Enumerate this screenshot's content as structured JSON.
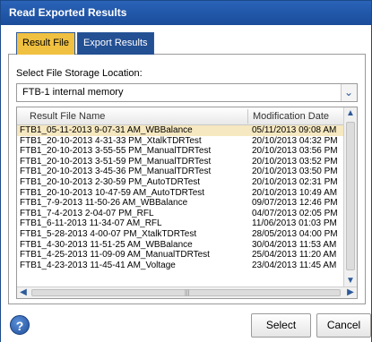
{
  "window": {
    "title": "Read Exported Results"
  },
  "tabs": [
    {
      "label": "Result File",
      "active": true
    },
    {
      "label": "Export Results",
      "active": false
    }
  ],
  "storage": {
    "label": "Select File Storage Location:",
    "selected": "FTB-1 internal memory"
  },
  "list": {
    "columns": {
      "name": "Result File Name",
      "date": "Modification Date"
    },
    "rows": [
      {
        "name": "FTB1_05-11-2013 9-07-31 AM_WBBalance",
        "date": "05/11/2013 09:08 AM"
      },
      {
        "name": "FTB1_20-10-2013 4-31-33 PM_XtalkTDRTest",
        "date": "20/10/2013 04:32 PM"
      },
      {
        "name": "FTB1_20-10-2013 3-55-55 PM_ManualTDRTest",
        "date": "20/10/2013 03:56 PM"
      },
      {
        "name": "FTB1_20-10-2013 3-51-59 PM_ManualTDRTest",
        "date": "20/10/2013 03:52 PM"
      },
      {
        "name": "FTB1_20-10-2013 3-45-36 PM_ManualTDRTest",
        "date": "20/10/2013 03:50 PM"
      },
      {
        "name": "FTB1_20-10-2013 2-30-59 PM_AutoTDRTest",
        "date": "20/10/2013 02:31 PM"
      },
      {
        "name": "FTB1_20-10-2013 10-47-59 AM_AutoTDRTest",
        "date": "20/10/2013 10:49 AM"
      },
      {
        "name": "FTB1_7-9-2013 11-50-26 AM_WBBalance",
        "date": "09/07/2013 12:46 PM"
      },
      {
        "name": "FTB1_7-4-2013 2-04-07 PM_RFL",
        "date": "04/07/2013 02:05 PM"
      },
      {
        "name": "FTB1_6-11-2013 11-34-07 AM_RFL",
        "date": "11/06/2013 01:03 PM"
      },
      {
        "name": "FTB1_5-28-2013 4-00-07 PM_XtalkTDRTest",
        "date": "28/05/2013 04:00 PM"
      },
      {
        "name": "FTB1_4-30-2013 11-51-25 AM_WBBalance",
        "date": "30/04/2013 11:53 AM"
      },
      {
        "name": "FTB1_4-25-2013 11-09-09 AM_ManualTDRTest",
        "date": "25/04/2013 11:20 AM"
      },
      {
        "name": "FTB1_4-23-2013 11-45-41 AM_Voltage",
        "date": "23/04/2013 11:45 AM"
      }
    ],
    "selected_index": 0
  },
  "icons": {
    "dropdown": "chevron-down-icon",
    "help": "help-icon",
    "scroll_up": "arrow-up-icon",
    "scroll_down": "arrow-down-icon",
    "scroll_left": "arrow-left-icon",
    "scroll_right": "arrow-right-icon"
  },
  "footer": {
    "help_glyph": "?",
    "select_label": "Select",
    "cancel_label": "Cancel"
  },
  "colors": {
    "title_bar": "#1a4c9a",
    "active_tab": "#f0c040",
    "inactive_tab": "#234f93",
    "selected_row": "#f6e8c0"
  }
}
